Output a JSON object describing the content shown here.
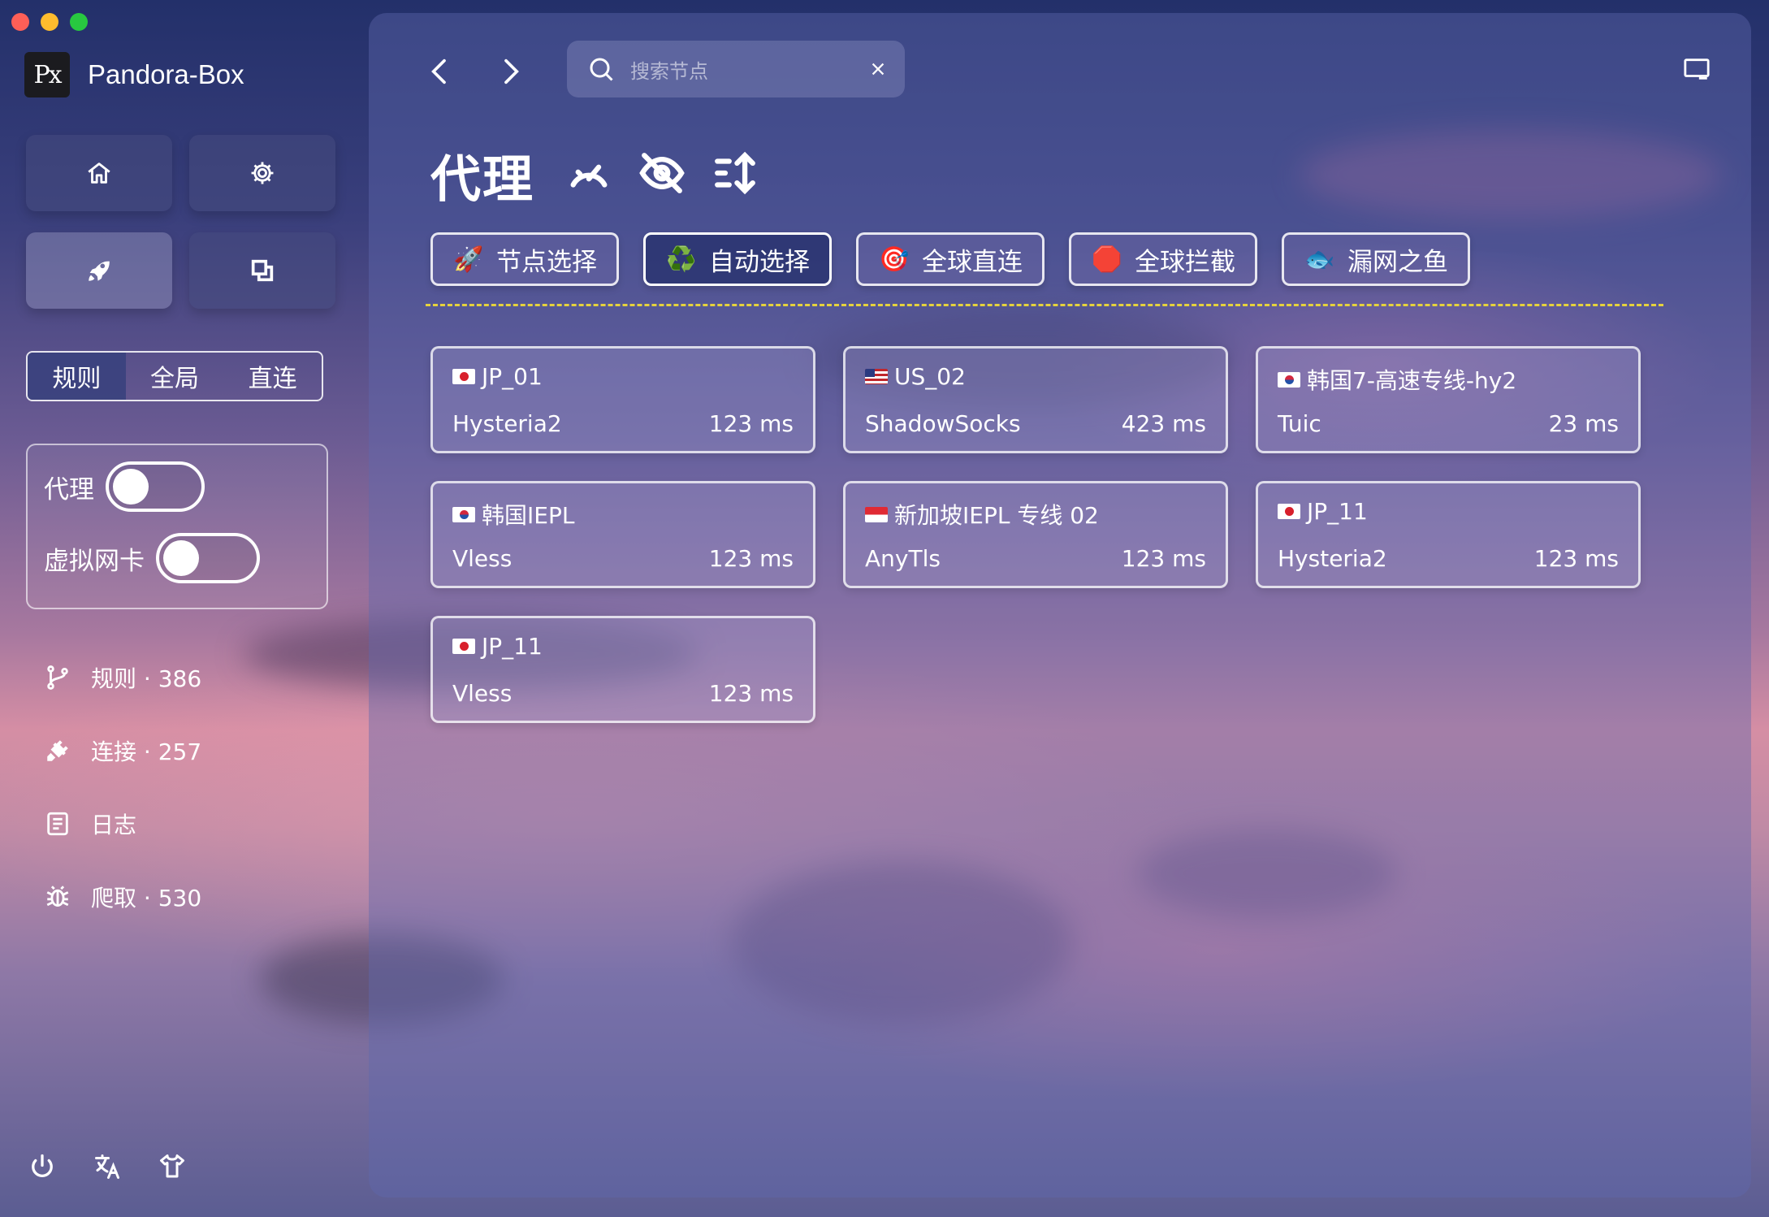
{
  "app": {
    "name": "Pandora-Box",
    "logo_text": "Px"
  },
  "sidebar": {
    "nav_buttons": [
      {
        "icon": "home-icon"
      },
      {
        "icon": "gear-icon"
      },
      {
        "icon": "rocket-icon",
        "active": true
      },
      {
        "icon": "copy-icon"
      }
    ],
    "modes": [
      "规则",
      "全局",
      "直连"
    ],
    "selected_mode": "规则",
    "toggles": [
      {
        "label": "代理",
        "on": false
      },
      {
        "label": "虚拟网卡",
        "on": false
      }
    ],
    "items": [
      {
        "icon": "branch-icon",
        "label": "规则 · 386"
      },
      {
        "icon": "plug-icon",
        "label": "连接 · 257"
      },
      {
        "icon": "document-icon",
        "label": "日志"
      },
      {
        "icon": "bug-icon",
        "label": "爬取 · 530"
      }
    ],
    "bottom_icons": [
      "power-icon",
      "translate-icon",
      "shirt-icon"
    ]
  },
  "header": {
    "search_placeholder": "搜索节点"
  },
  "page": {
    "title": "代理",
    "title_icons": [
      "speedometer-icon",
      "eye-off-icon",
      "sort-icon"
    ]
  },
  "groups": [
    {
      "emoji": "🚀",
      "label": "节点选择",
      "active": false
    },
    {
      "emoji": "♻️",
      "label": "自动选择",
      "active": true
    },
    {
      "emoji": "🎯",
      "label": "全球直连",
      "active": false
    },
    {
      "emoji": "🛑",
      "label": "全球拦截",
      "active": false
    },
    {
      "emoji": "🐟",
      "label": "漏网之鱼",
      "active": false
    }
  ],
  "nodes": [
    {
      "flag": "jp",
      "name": "JP_01",
      "protocol": "Hysteria2",
      "delay": "123 ms"
    },
    {
      "flag": "us",
      "name": "US_02",
      "protocol": "ShadowSocks",
      "delay": "423 ms"
    },
    {
      "flag": "kr",
      "name": "韩国7-高速专线-hy2",
      "protocol": "Tuic",
      "delay": "23 ms"
    },
    {
      "flag": "kr",
      "name": "韩国IEPL",
      "protocol": "Vless",
      "delay": "123 ms"
    },
    {
      "flag": "sg",
      "name": "新加坡IEPL 专线 02",
      "protocol": "AnyTls",
      "delay": "123 ms"
    },
    {
      "flag": "jp",
      "name": "JP_11",
      "protocol": "Hysteria2",
      "delay": "123 ms"
    },
    {
      "flag": "jp",
      "name": "JP_11",
      "protocol": "Vless",
      "delay": "123 ms"
    }
  ],
  "colors": {
    "traffic_close": "#fe5f57",
    "traffic_min": "#febc2e",
    "traffic_max": "#28c840",
    "group_divider": "#e5d23c"
  }
}
